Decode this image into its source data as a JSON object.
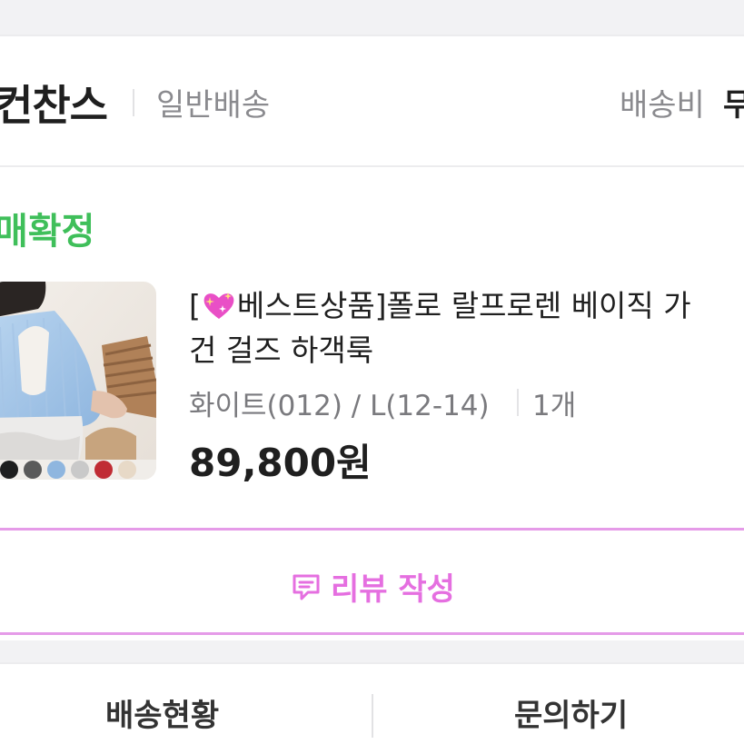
{
  "store": {
    "name": "컨찬스",
    "shipping_type": "일반배송",
    "shipping_fee_label": "배송비",
    "shipping_fee_value": "무"
  },
  "order": {
    "status": "매확정"
  },
  "product": {
    "title_line1_prefix": "[",
    "title_line1_icon": "sparkling-heart-icon",
    "title_line1_rest": "베스트상품]폴로 랄프로렌 베이직 가",
    "title_line2": "건 걸즈 하객룩",
    "option": "화이트(012) / L(12-14)",
    "quantity": "1개",
    "price": "89,800원"
  },
  "review_button": {
    "label": "리뷰 작성",
    "icon": "chat-bubble-icon",
    "color": "#e56fe0",
    "border_color": "#e59be8"
  },
  "bottom_actions": {
    "delivery_status": "배송현황",
    "inquiry": "문의하기"
  },
  "colors": {
    "status_green": "#3fbf5a",
    "text_dark": "#1f1f1f",
    "text_gray": "#8a8a8e"
  }
}
